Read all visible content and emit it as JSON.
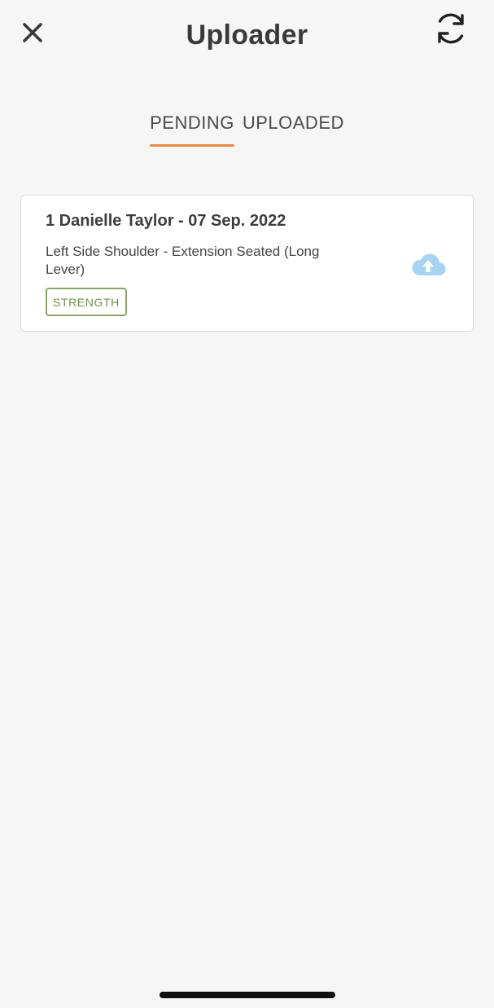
{
  "header": {
    "title": "Uploader",
    "close_icon": "close-icon",
    "refresh_icon": "refresh-icon"
  },
  "tabs": [
    {
      "label": "PENDING",
      "active": true
    },
    {
      "label": "UPLOADED",
      "active": false
    }
  ],
  "uploads": [
    {
      "title": "1 Danielle Taylor - 07 Sep. 2022",
      "description": "Left Side Shoulder - Extension Seated (Long Lever)",
      "tag": "STRENGTH",
      "action_icon": "cloud-upload-icon"
    }
  ],
  "colors": {
    "background": "#f6f6f6",
    "accent": "#e98a45",
    "tag": "#6f9145",
    "upload_icon": "#a9d3f3"
  }
}
